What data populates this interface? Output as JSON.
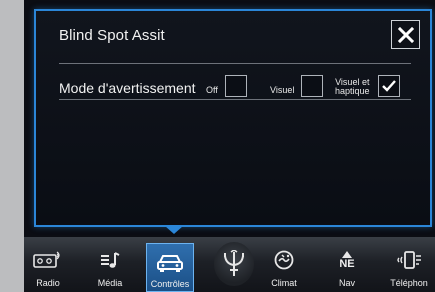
{
  "dialog": {
    "title": "Blind Spot Assit",
    "close_label": "✕",
    "row_label": "Mode d'avertissement",
    "options": [
      {
        "label": "Off",
        "checked": false
      },
      {
        "label": "Visuel",
        "checked": false
      },
      {
        "label_line1": "Visuel et",
        "label_line2": "haptique",
        "checked": true
      }
    ]
  },
  "navbar": {
    "items": [
      {
        "label": "Radio",
        "icon": "radio-icon"
      },
      {
        "label": "Média",
        "icon": "media-icon"
      },
      {
        "label": "Contrôles",
        "icon": "car-controls-icon",
        "active": true
      },
      {
        "label": "",
        "icon": "trident-logo-icon"
      },
      {
        "label": "Climat",
        "icon": "climate-icon"
      },
      {
        "label": "Nav",
        "icon": "compass-icon",
        "sub": "NE"
      },
      {
        "label": "Téléphon",
        "icon": "phone-icon"
      }
    ]
  },
  "colors": {
    "accent": "#2b86d8",
    "background": "#0b0d13",
    "text": "#f2f2f2"
  }
}
